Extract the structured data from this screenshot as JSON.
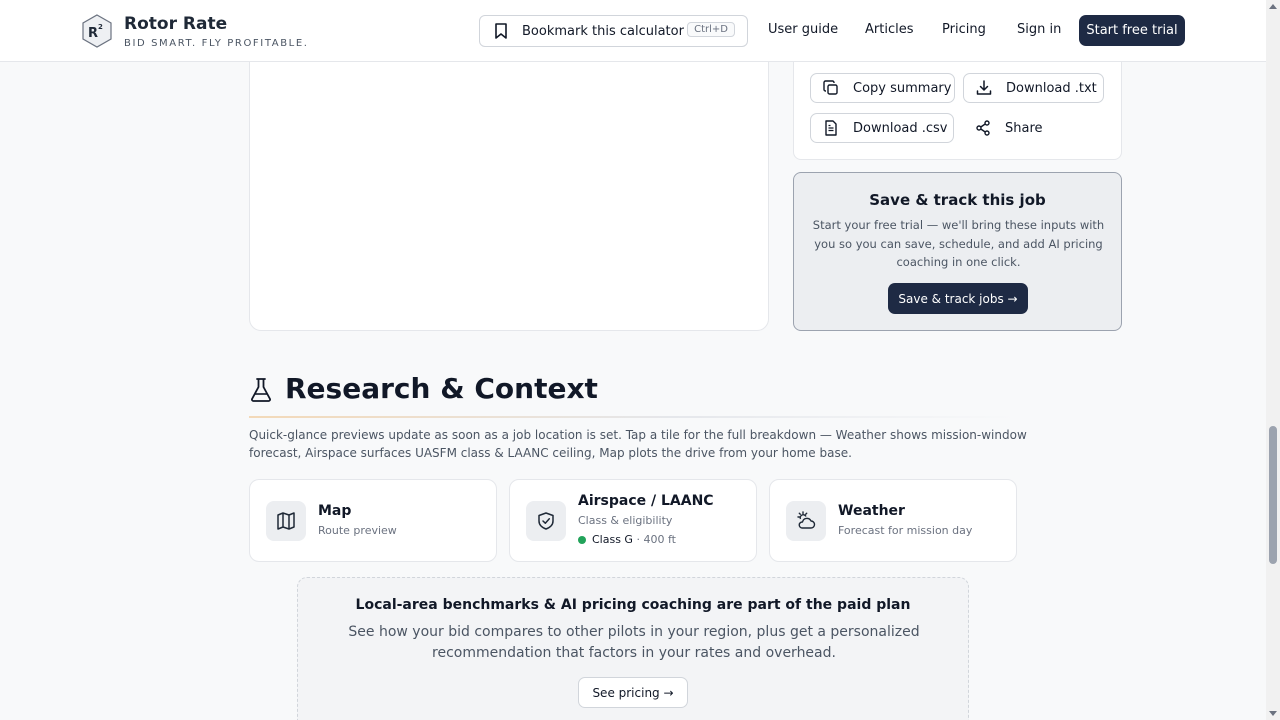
{
  "header": {
    "logo_text": "R²",
    "brand_name": "Rotor Rate",
    "tagline": "BID SMART. FLY PROFITABLE.",
    "bookmark_label": "Bookmark this calculator",
    "bookmark_shortcut": "Ctrl+D",
    "nav": [
      "User guide",
      "Articles",
      "Pricing",
      "Sign in"
    ],
    "cta_label": "Start free trial"
  },
  "export": {
    "copy_label": "Copy summary",
    "txt_label": "Download .txt",
    "csv_label": "Download .csv",
    "share_label": "Share"
  },
  "save_card": {
    "title": "Save & track this job",
    "body": "Start your free trial — we'll bring these inputs with you so you can save, schedule, and add AI pricing coaching in one click.",
    "button": "Save & track jobs →"
  },
  "research": {
    "title": "Research & Context",
    "description": "Quick-glance previews update as soon as a job location is set. Tap a tile for the full breakdown — Weather shows mission-window forecast, Airspace surfaces UASFM class & LAANC ceiling, Map plots the drive from your home base.",
    "tiles": [
      {
        "title": "Map",
        "subtitle": "Route preview",
        "icon": "map-icon"
      },
      {
        "title": "Airspace / LAANC",
        "subtitle": "Class & eligibility",
        "icon": "shield-check-icon",
        "status_class": "Class G",
        "status_ceiling": "· 400 ft",
        "status_color": "#22a35a"
      },
      {
        "title": "Weather",
        "subtitle": "Forecast for mission day",
        "icon": "cloud-sun-icon"
      }
    ]
  },
  "promo": {
    "title": "Local-area benchmarks & AI pricing coaching are part of the paid plan",
    "body": "See how your bid compares to other pilots in your region, plus get a personalized recommendation that factors in your rates and overhead.",
    "button": "See pricing →"
  },
  "colors": {
    "primary": "#1e2a44",
    "accent_rule": "#f3d9b8"
  }
}
